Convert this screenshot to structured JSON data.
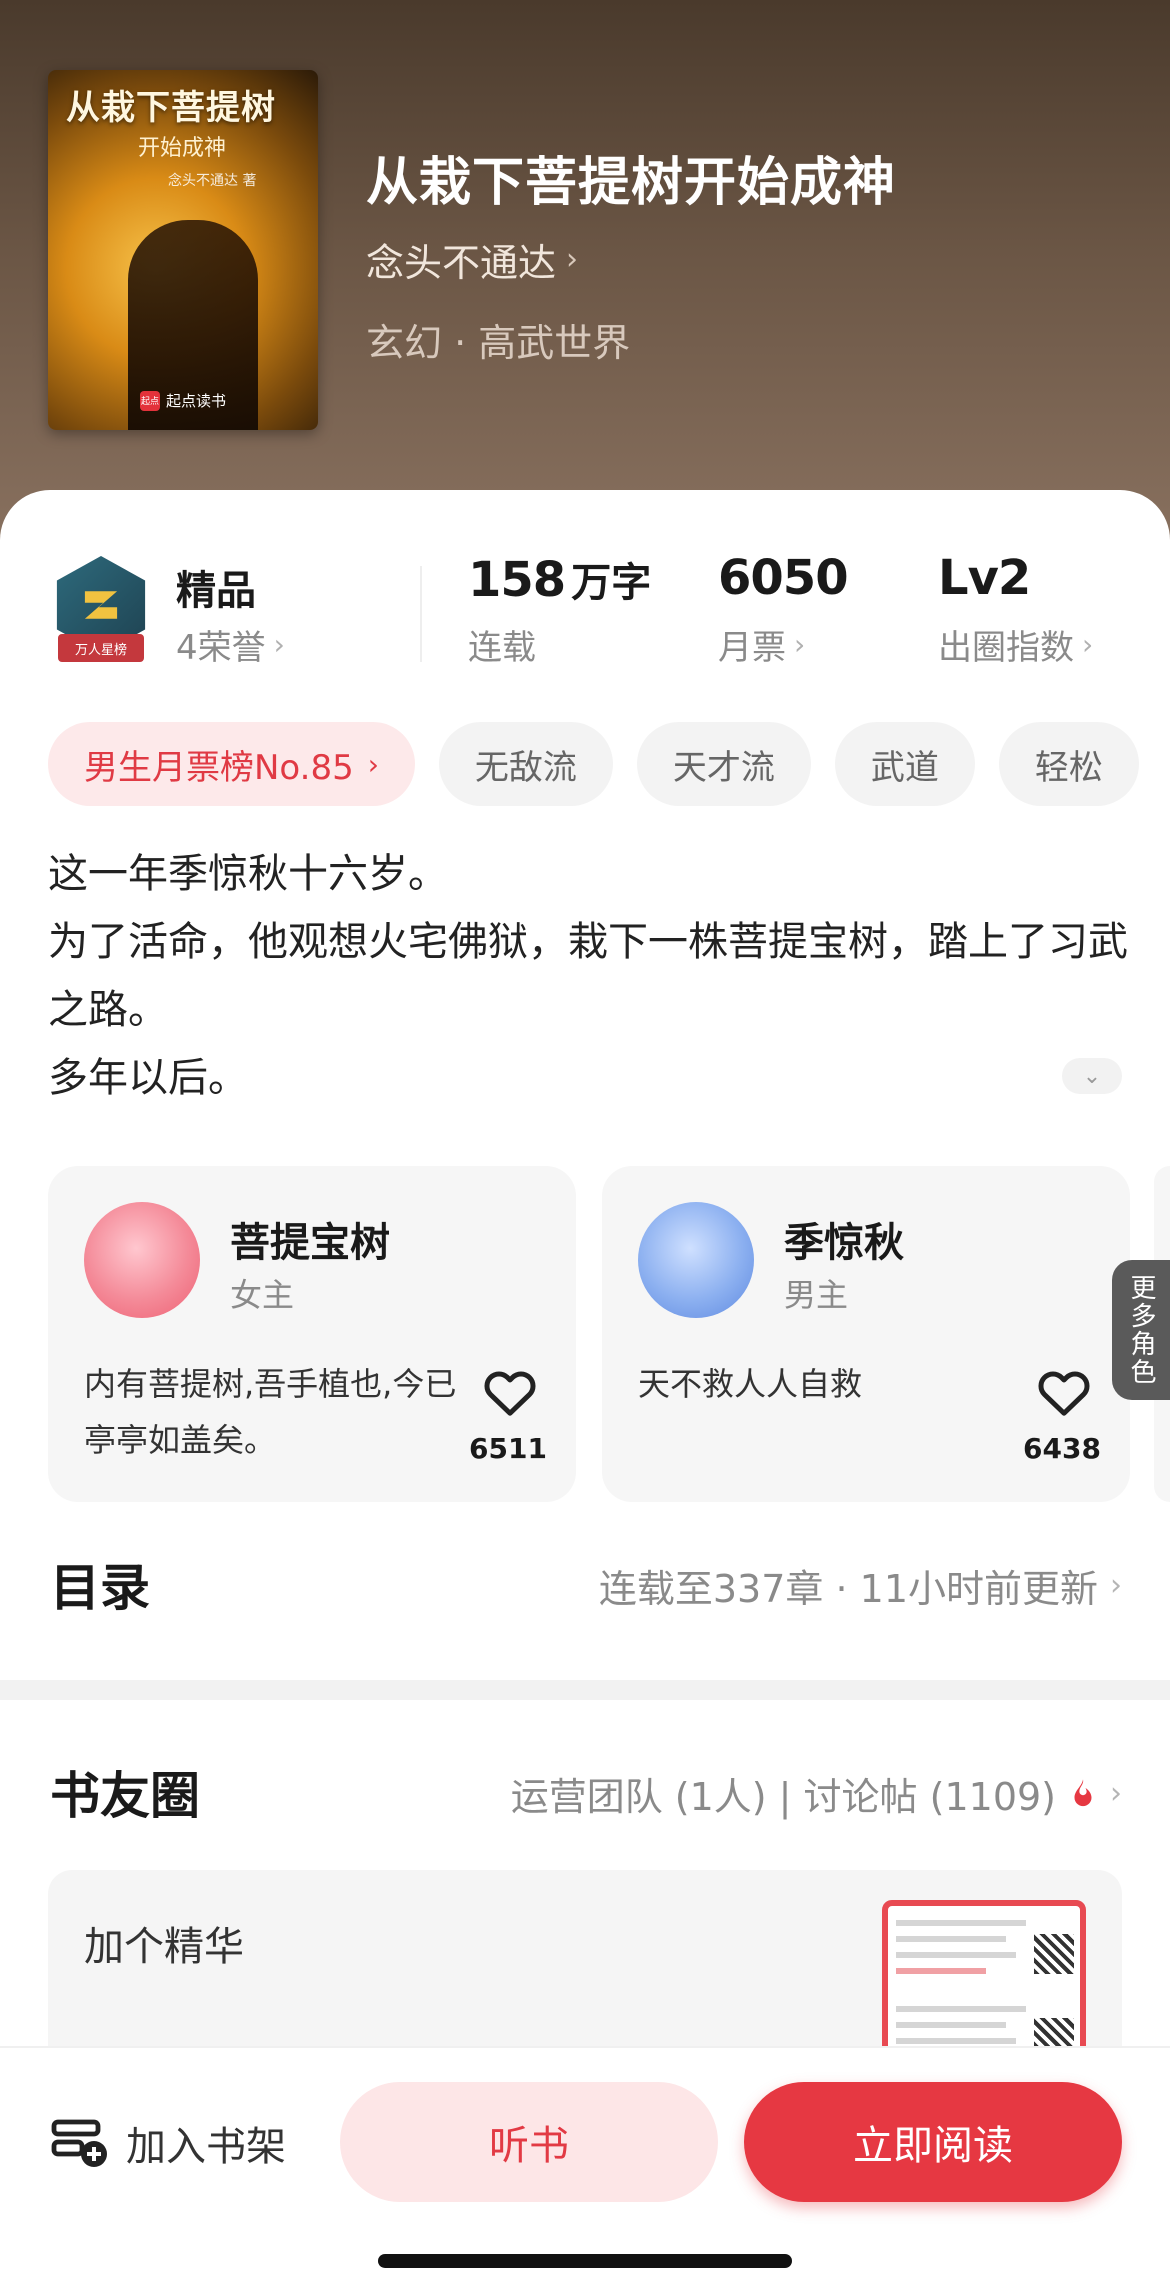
{
  "book": {
    "cover_title": "从栽下菩提树",
    "cover_subtitle": "开始成神",
    "cover_author": "念头不通达 著",
    "cover_brand": "起点读书",
    "cover_brand_logo": "起点",
    "title": "从栽下菩提树开始成神",
    "author": "念头不通达",
    "genre": "玄幻 · 高武世界"
  },
  "stats": {
    "badge_ribbon": "万人星榜",
    "honor_title": "精品",
    "honor_sub": "4荣誉",
    "words_value": "158",
    "words_unit": "万字",
    "words_sub": "连载",
    "tickets_value": "6050",
    "tickets_sub": "月票",
    "level_value": "Lv2",
    "level_sub": "出圈指数"
  },
  "tags": [
    "男生月票榜No.85",
    "无敌流",
    "天才流",
    "武道",
    "轻松"
  ],
  "intro": {
    "line1": "这一年季惊秋十六岁。",
    "line2": "为了活命，他观想火宅佛狱，栽下一株菩提宝树，踏上了习武之路。",
    "line3": "多年以后。"
  },
  "roles": [
    {
      "name": "菩提宝树",
      "type": "女主",
      "quote": "内有菩提树,吾手植也,今已亭亭如盖矣。",
      "likes": "6511",
      "avatar_color": "#f06a7a"
    },
    {
      "name": "季惊秋",
      "type": "男主",
      "quote": "天不救人人自救",
      "likes": "6438",
      "avatar_color": "#6a95e8"
    }
  ],
  "more_roles": "更多角色",
  "catalog": {
    "title": "目录",
    "status": "连载至337章 · 11小时前更新"
  },
  "community": {
    "title": "书友圈",
    "info": "运营团队 (1人) | 讨论帖 (1109)",
    "post_text": "加个精华"
  },
  "bottom_bar": {
    "shelf_label": "加入书架",
    "listen_label": "听书",
    "read_label": "立即阅读"
  },
  "colors": {
    "accent": "#e63842",
    "accent_light": "#fde6e7"
  }
}
